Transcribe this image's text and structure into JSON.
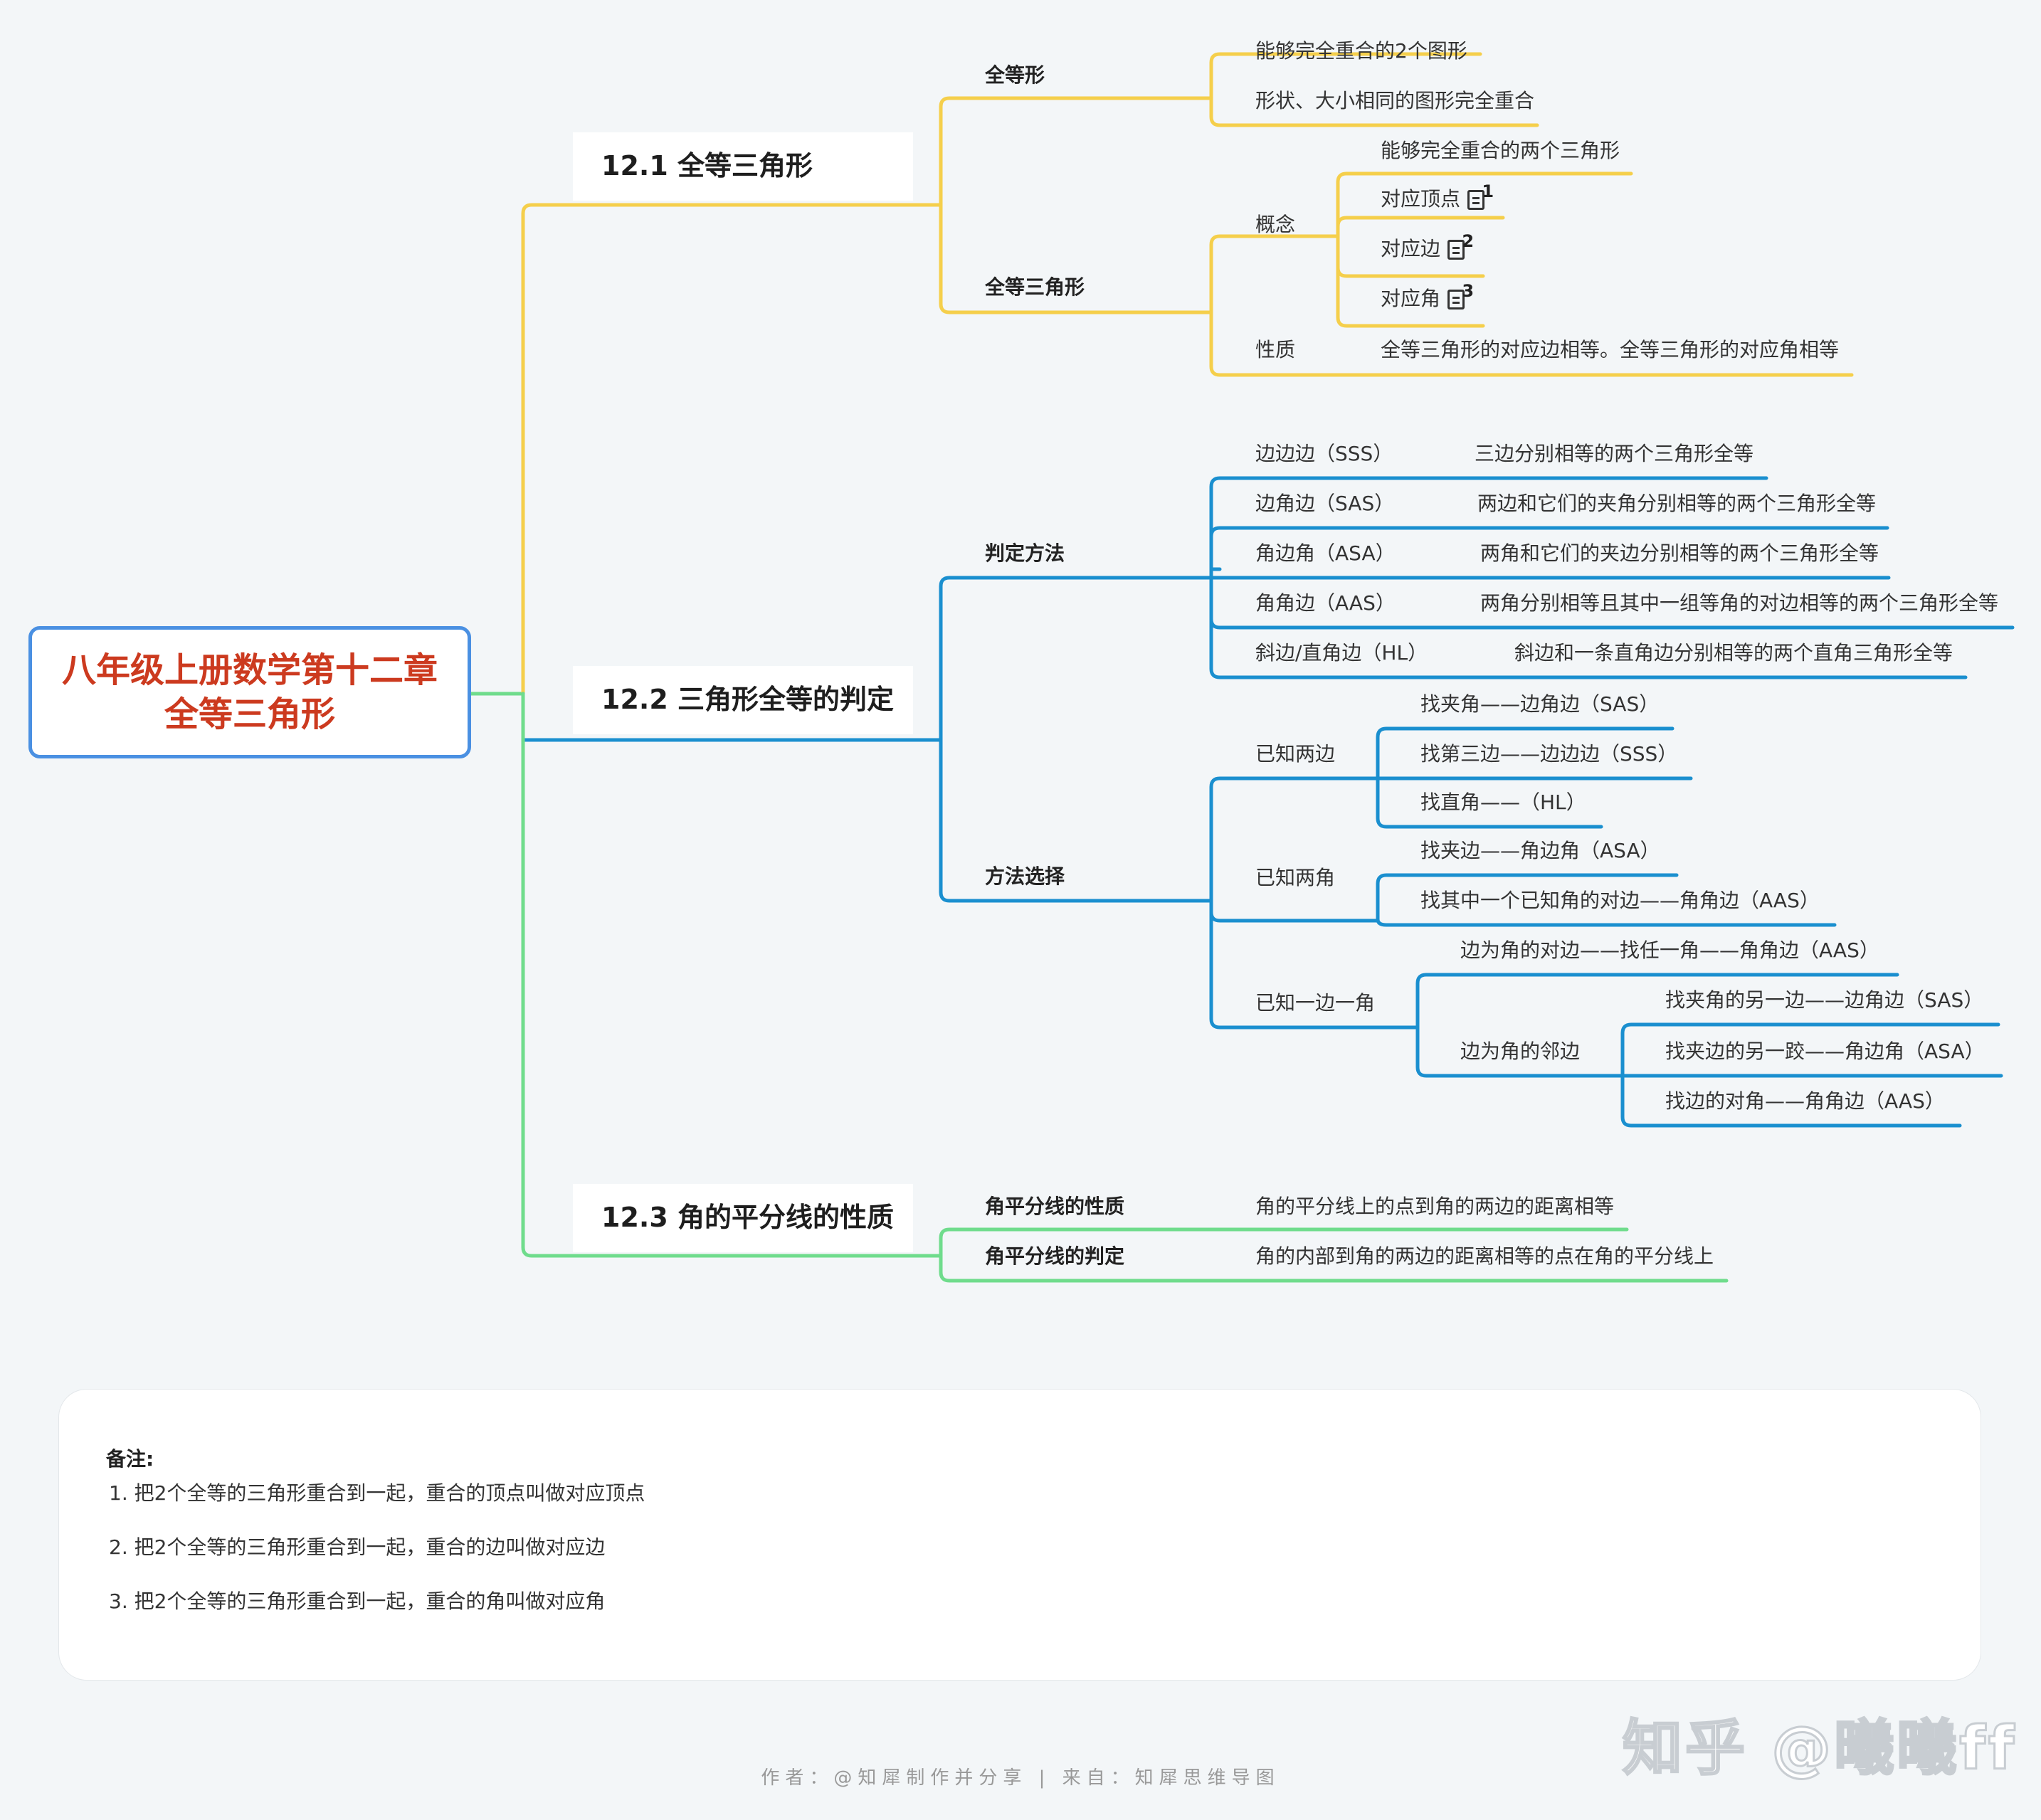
{
  "root": {
    "line1": "八年级上册数学第十二章",
    "line2": "全等三角形"
  },
  "colors": {
    "s1": "#f5cf4b",
    "s2": "#1a8fcf",
    "s3": "#6fdc8c",
    "root_border": "#4a90e2",
    "root_text": "#cc3a1f"
  },
  "section1": {
    "title": "12.1 全等三角形",
    "congruent_shape": {
      "label": "全等形",
      "items": [
        "能够完全重合的2个图形",
        "形状、大小相同的图形完全重合"
      ]
    },
    "congruent_triangle": {
      "label": "全等三角形",
      "concept": {
        "label": "概念",
        "definition": "能够完全重合的两个三角形",
        "items": [
          {
            "label": "对应顶点",
            "note": "1"
          },
          {
            "label": "对应边",
            "note": "2"
          },
          {
            "label": "对应角",
            "note": "3"
          }
        ]
      },
      "property": {
        "label": "性质",
        "text": "全等三角形的对应边相等。全等三角形的对应角相等"
      }
    }
  },
  "section2": {
    "title": "12.2 三角形全等的判定",
    "methods": {
      "label": "判定方法",
      "items": [
        {
          "name": "边边边（SSS）",
          "desc": "三边分别相等的两个三角形全等"
        },
        {
          "name": "边角边（SAS）",
          "desc": "两边和它们的夹角分别相等的两个三角形全等"
        },
        {
          "name": "角边角（ASA）",
          "desc": "两角和它们的夹边分别相等的两个三角形全等"
        },
        {
          "name": "角角边（AAS）",
          "desc": "两角分别相等且其中一组等角的对边相等的两个三角形全等"
        },
        {
          "name": "斜边/直角边（HL）",
          "desc": "斜边和一条直角边分别相等的两个直角三角形全等"
        }
      ]
    },
    "choice": {
      "label": "方法选择",
      "two_sides": {
        "label": "已知两边",
        "items": [
          "找夹角——边角边（SAS）",
          "找第三边——边边边（SSS）",
          "找直角——（HL）"
        ]
      },
      "two_angles": {
        "label": "已知两角",
        "items": [
          "找夹边——角边角（ASA）",
          "找其中一个已知角的对边——角角边（AAS）"
        ]
      },
      "side_angle": {
        "label": "已知一边一角",
        "opposite": "边为角的对边——找任一角——角角边（AAS）",
        "adjacent": {
          "label": "边为角的邻边",
          "items": [
            "找夹角的另一边——边角边（SAS）",
            "找夹边的另一跤——角边角（ASA）",
            "找边的对角——角角边（AAS）"
          ]
        }
      }
    }
  },
  "section3": {
    "title": "12.3 角的平分线的性质",
    "property": {
      "label": "角平分线的性质",
      "text": "角的平分线上的点到角的两边的距离相等"
    },
    "criterion": {
      "label": "角平分线的判定",
      "text": "角的内部到角的两边的距离相等的点在角的平分线上"
    }
  },
  "notes": {
    "title": "备注:",
    "items": [
      "1. 把2个全等的三角形重合到一起，重合的顶点叫做对应顶点",
      "2. 把2个全等的三角形重合到一起，重合的边叫做对应边",
      "3. 把2个全等的三角形重合到一起，重合的角叫做对应角"
    ]
  },
  "footer": "作者：@知犀制作并分享 | 来自：知犀思维导图",
  "watermark": "知乎 @曦曦ff"
}
